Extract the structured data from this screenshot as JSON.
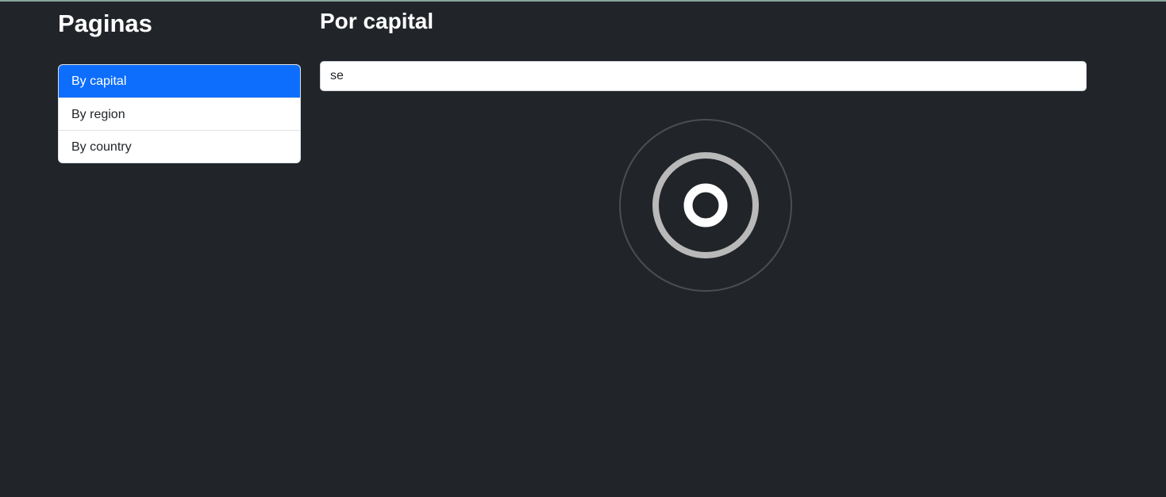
{
  "sidebar": {
    "title": "Paginas",
    "items": [
      {
        "label": "By capital",
        "active": true
      },
      {
        "label": "By region",
        "active": false
      },
      {
        "label": "By country",
        "active": false
      }
    ]
  },
  "main": {
    "title": "Por capital",
    "search": {
      "value": "se",
      "placeholder": ""
    },
    "loader": {
      "icon": "loading-spinner-icon"
    }
  },
  "colors": {
    "background": "#212529",
    "accent": "#0d6efd",
    "text": "#ffffff"
  }
}
